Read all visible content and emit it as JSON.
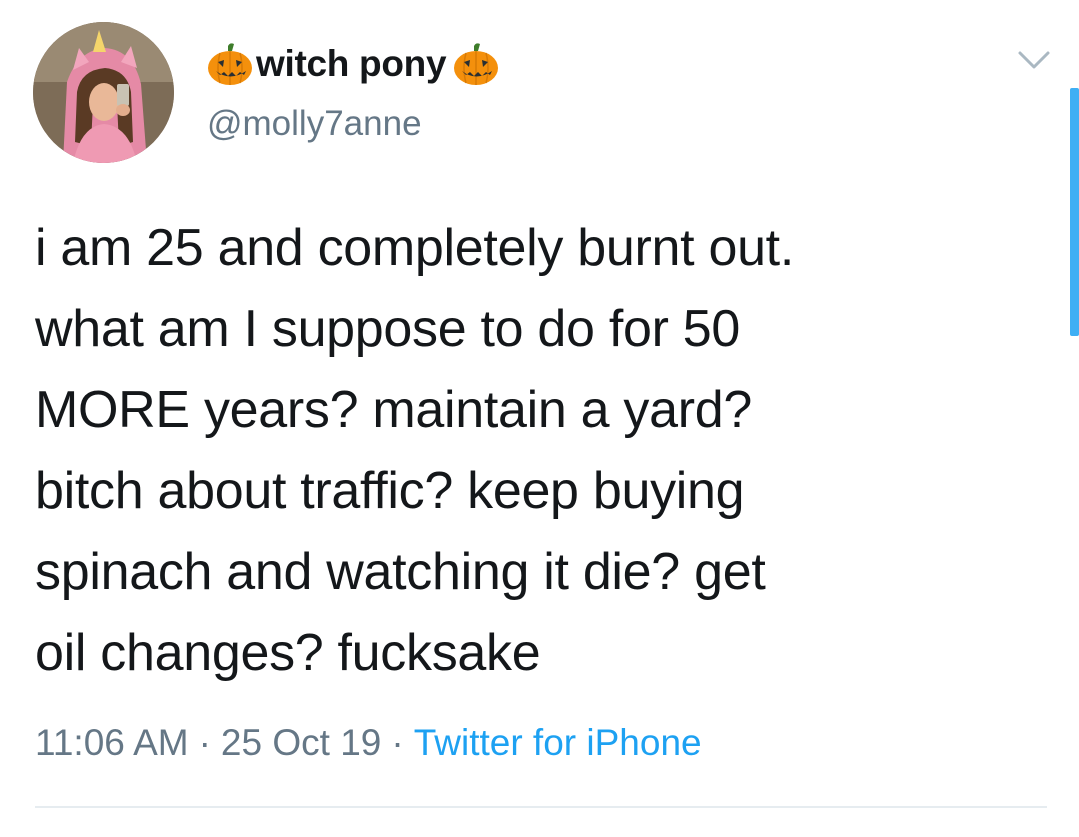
{
  "author": {
    "display_name": "witch pony",
    "handle": "@molly7anne",
    "name_decoration_icon": "jack-o-lantern-icon"
  },
  "tweet": {
    "lines": [
      "i am 25 and completely burnt out.",
      "what am I suppose to do for 50",
      "MORE years? maintain a yard?",
      "bitch about traffic? keep buying",
      "spinach and watching it die? get",
      "oil changes? fucksake"
    ]
  },
  "meta": {
    "time": "11:06 AM",
    "separator": "·",
    "date": "25 Oct 19",
    "source": "Twitter for iPhone"
  },
  "colors": {
    "text": "#14171a",
    "secondary": "#657786",
    "accent": "#1da1f2",
    "pumpkin": "#f4900c"
  }
}
